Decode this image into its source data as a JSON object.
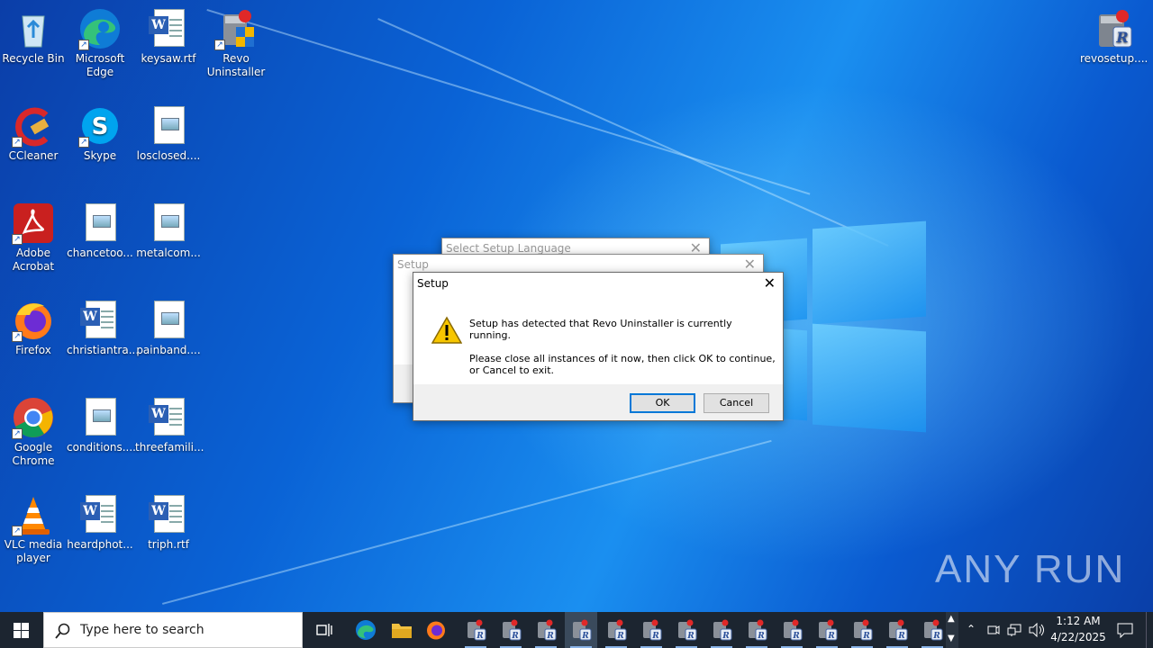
{
  "desktop_icons": [
    {
      "label": "Recycle Bin",
      "icon": "recycle-bin-icon"
    },
    {
      "label": "Microsoft Edge",
      "icon": "edge-icon"
    },
    {
      "label": "keysaw.rtf",
      "icon": "word-document-icon"
    },
    {
      "label": "Revo Uninstaller",
      "icon": "revo-uninstaller-icon"
    },
    {
      "label": "CCleaner",
      "icon": "ccleaner-icon"
    },
    {
      "label": "Skype",
      "icon": "skype-icon"
    },
    {
      "label": "losclosed....",
      "icon": "image-file-icon"
    },
    {
      "label": "Adobe Acrobat",
      "icon": "adobe-acrobat-icon"
    },
    {
      "label": "chancetoo...",
      "icon": "image-file-icon"
    },
    {
      "label": "metalcom...",
      "icon": "image-file-icon"
    },
    {
      "label": "Firefox",
      "icon": "firefox-icon"
    },
    {
      "label": "christiantra...",
      "icon": "word-document-icon"
    },
    {
      "label": "painband....",
      "icon": "image-file-icon"
    },
    {
      "label": "Google Chrome",
      "icon": "chrome-icon"
    },
    {
      "label": "conditions....",
      "icon": "image-file-icon"
    },
    {
      "label": "threefamili...",
      "icon": "word-document-icon"
    },
    {
      "label": "VLC media player",
      "icon": "vlc-icon"
    },
    {
      "label": "heardphot...",
      "icon": "word-document-icon"
    },
    {
      "label": "triph.rtf",
      "icon": "word-document-icon"
    },
    {
      "label": "revosetup....",
      "icon": "revo-setup-icon"
    }
  ],
  "dialogs": {
    "language": {
      "title": "Select Setup Language"
    },
    "setup_back": {
      "title": "Setup"
    },
    "setup_front": {
      "title": "Setup",
      "message_1": "Setup has detected that Revo Uninstaller is currently running.",
      "message_2": "Please close all instances of it now, then click OK to continue,",
      "message_3": "or Cancel to exit.",
      "ok_label": "OK",
      "cancel_label": "Cancel"
    }
  },
  "taskbar": {
    "search_placeholder": "Type here to search",
    "time": "1:12 AM",
    "date": "4/22/2025",
    "revo_instances": 14
  },
  "watermark": "ANY RUN",
  "colors": {
    "accent": "#0078d7",
    "taskbar": "#1c2530",
    "warning": "#f7c600"
  }
}
